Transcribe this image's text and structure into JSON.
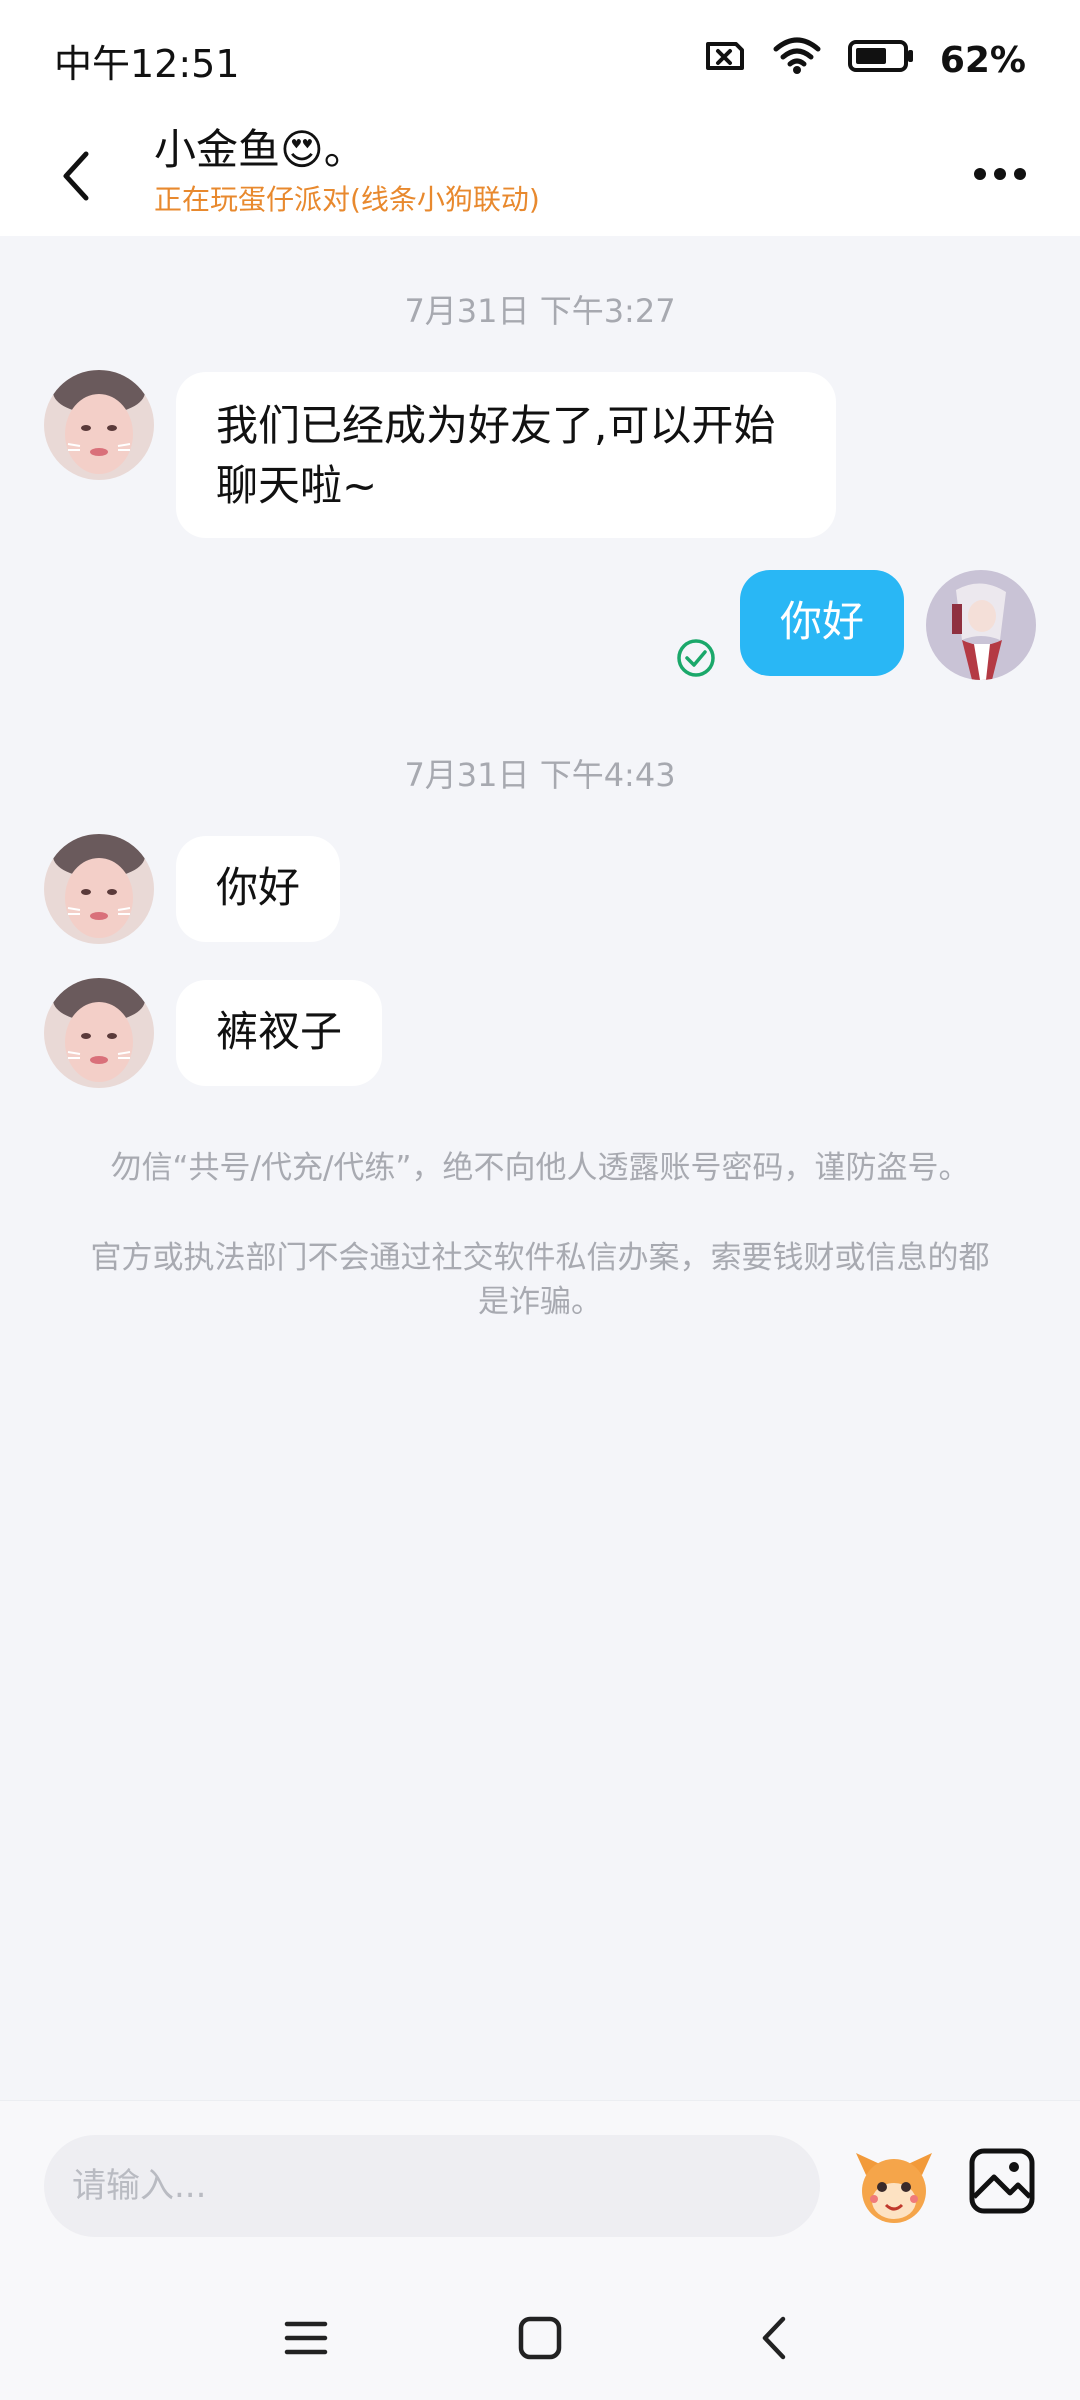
{
  "status_bar": {
    "time": "中午12:51",
    "battery": "62%",
    "icons": [
      "sim-off-icon",
      "wifi-icon",
      "battery-icon"
    ]
  },
  "header": {
    "title": "小金鱼😍。",
    "subtitle": "正在玩蛋仔派对(线条小狗联动)",
    "back_icon": "chevron-left-icon",
    "more_icon": "more-horizontal-icon"
  },
  "messages": [
    {
      "type": "timestamp",
      "text": "7月31日 下午3:27"
    },
    {
      "type": "received",
      "text": "我们已经成为好友了,可以开始聊天啦~"
    },
    {
      "type": "sent",
      "text": "你好",
      "status": "read"
    },
    {
      "type": "timestamp",
      "text": "7月31日 下午4:43"
    },
    {
      "type": "received",
      "text": "你好"
    },
    {
      "type": "received",
      "text": "裤衩子"
    }
  ],
  "notices": [
    "勿信“共号/代充/代练”，绝不向他人透露账号密码，谨防盗号。",
    "官方或执法部门不会通过社交软件私信办案，索要钱财或信息的都是诈骗。"
  ],
  "input": {
    "placeholder": "请输入...",
    "emoji_icon": "emoji-mascot-icon",
    "image_icon": "image-icon"
  },
  "nav": {
    "icons": [
      "menu-icon",
      "home-square-icon",
      "back-icon"
    ]
  },
  "colors": {
    "accent": "#29b7f5",
    "subtitle": "#e8892e",
    "read_check": "#1aa86a",
    "background": "#f4f5f9"
  }
}
